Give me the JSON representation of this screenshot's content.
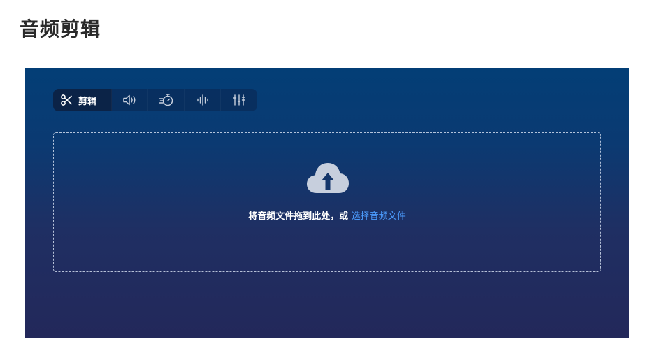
{
  "page": {
    "title": "音频剪辑"
  },
  "toolbar": {
    "tools": [
      {
        "icon": "scissors-icon",
        "label": "剪辑",
        "active": true
      },
      {
        "icon": "volume-icon",
        "label": "",
        "active": false
      },
      {
        "icon": "speed-timer-icon",
        "label": "",
        "active": false
      },
      {
        "icon": "waveform-icon",
        "label": "",
        "active": false
      },
      {
        "icon": "equalizer-icon",
        "label": "",
        "active": false
      }
    ]
  },
  "dropzone": {
    "icon": "cloud-upload-icon",
    "text": "将音频文件拖到此处，或 ",
    "link_text": "选择音频文件"
  },
  "colors": {
    "panel_top": "#033e76",
    "panel_bottom": "#23285a",
    "link": "#4c9dff",
    "icon": "#c7cfdd"
  }
}
